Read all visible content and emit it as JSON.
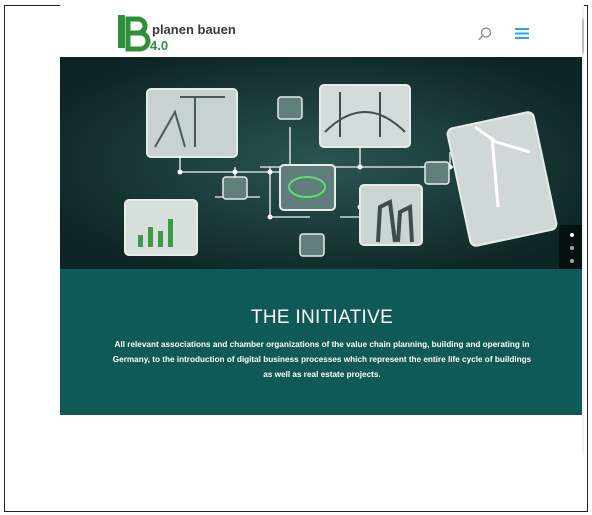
{
  "header": {
    "logo_text": "planen bauen",
    "logo_version": "4.0",
    "search_icon": "search-icon",
    "menu_icon": "hamburger-menu-icon",
    "brand_green": "#2f8f3a",
    "menu_blue": "#2ea3f2"
  },
  "hero": {
    "background": "#11302f",
    "dot_count": 8,
    "active_dot": 0
  },
  "initiative": {
    "title": "THE INITIATIVE",
    "text": "All relevant associations and chamber organizations of the value chain planning, building and operating in Germany, to the introduction of digital business processes which represent the entire life cycle of buildings as well as real estate projects.",
    "background": "#0f5a57"
  }
}
